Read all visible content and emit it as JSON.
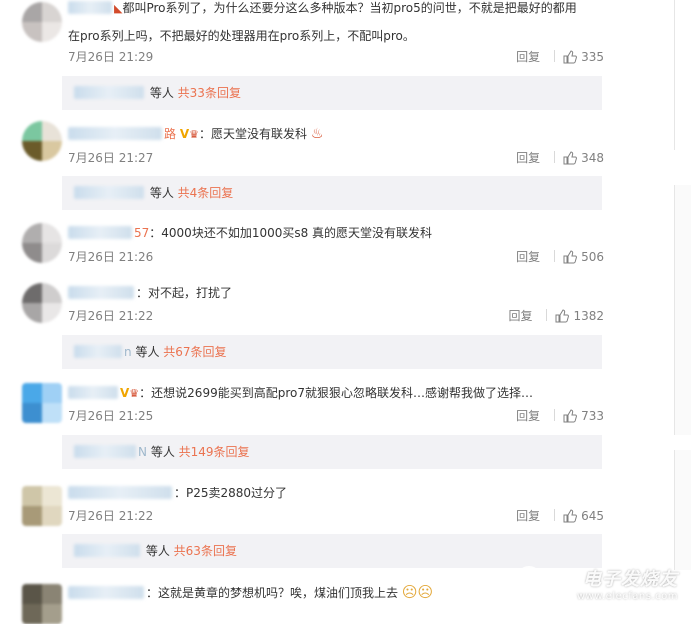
{
  "comments": [
    {
      "name_tail": "",
      "badges": "",
      "text": "都叫Pro系列了，为什么还要分这么多种版本？当初pro5的问世，不就是把最好的都用",
      "text2": "在pro系列上吗，不把最好的处理器用在pro系列上，不配叫pro。",
      "time": "7月26日 21:29",
      "reply_label": "回复",
      "likes": "335",
      "replies_suffix": "等人",
      "replies_link": "共33条回复"
    },
    {
      "name_tail": "路",
      "badges": "V",
      "text": "：愿天堂没有联发科",
      "time": "7月26日 21:27",
      "reply_label": "回复",
      "likes": "348",
      "replies_suffix": "等人",
      "replies_link": "共4条回复"
    },
    {
      "name_tail": "57",
      "badges": "",
      "text": "：4000块还不如加1000买s8 真的愿天堂没有联发科",
      "time": "7月26日 21:26",
      "reply_label": "回复",
      "likes": "506"
    },
    {
      "name_tail": "",
      "badges": "",
      "text": "：对不起，打扰了",
      "time": "7月26日 21:22",
      "reply_label": "回复",
      "likes": "1382",
      "replies_prefix": "n",
      "replies_suffix": "等人",
      "replies_link": "共67条回复"
    },
    {
      "name_tail": "",
      "badges": "V",
      "text": "：还想说2699能买到高配pro7就狠狠心忽略联发科…感谢帮我做了选择…",
      "time": "7月26日 21:25",
      "reply_label": "回复",
      "likes": "733",
      "replies_prefix": "N",
      "replies_suffix": "等人",
      "replies_link": "共149条回复"
    },
    {
      "name_tail": "",
      "badges": "",
      "text": "：P25卖2880过分了",
      "time": "7月26日 21:22",
      "reply_label": "回复",
      "likes": "645",
      "replies_suffix": "等人",
      "replies_link": "共63条回复"
    },
    {
      "name_tail": "",
      "badges": "",
      "text": "：这就是黄章的梦想机吗？唉，煤油们顶我上去"
    }
  ],
  "watermark": {
    "title": "电子发烧友",
    "url": "www.elecfans.com"
  },
  "colors": {
    "link": "#eb7350",
    "meta": "#808080",
    "reply_bar": "#f2f2f5"
  },
  "icons": [
    "thumb-up-icon",
    "verified-v-icon",
    "fire-icon",
    "sad-face-icon"
  ]
}
